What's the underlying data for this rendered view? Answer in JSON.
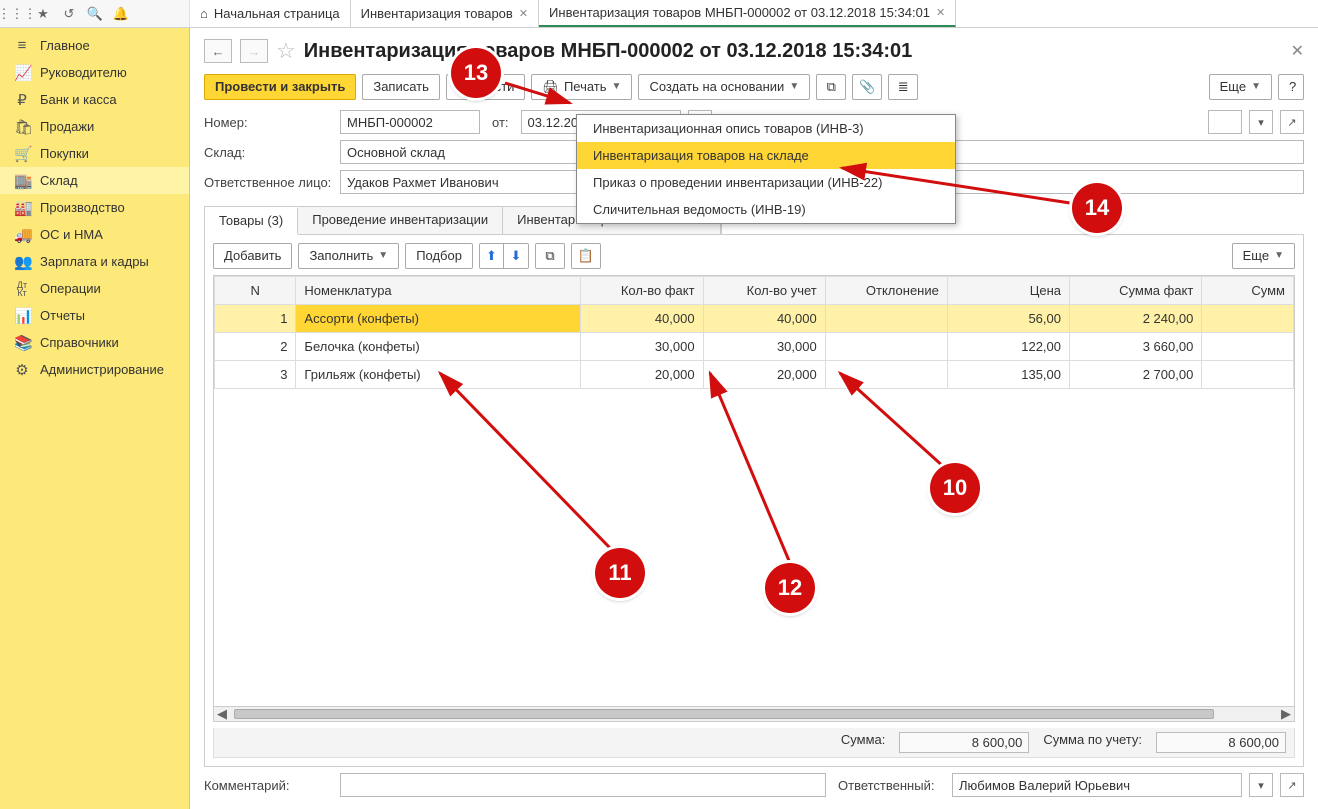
{
  "tabs": {
    "home": "Начальная страница",
    "t1": "Инвентаризация товаров",
    "t2": "Инвентаризация товаров МНБП-000002 от 03.12.2018 15:34:01"
  },
  "sidebar": [
    {
      "icon": "≡",
      "label": "Главное"
    },
    {
      "icon": "📈",
      "label": "Руководителю"
    },
    {
      "icon": "₽",
      "label": "Банк и касса"
    },
    {
      "icon": "🛍",
      "label": "Продажи"
    },
    {
      "icon": "🛒",
      "label": "Покупки"
    },
    {
      "icon": "🏬",
      "label": "Склад"
    },
    {
      "icon": "🏭",
      "label": "Производство"
    },
    {
      "icon": "🚚",
      "label": "ОС и НМА"
    },
    {
      "icon": "👥",
      "label": "Зарплата и кадры"
    },
    {
      "icon": "Дт Кт",
      "label": "Операции"
    },
    {
      "icon": "📊",
      "label": "Отчеты"
    },
    {
      "icon": "📚",
      "label": "Справочники"
    },
    {
      "icon": "⚙",
      "label": "Администрирование"
    }
  ],
  "title": "Инвентаризация товаров МНБП-000002 от 03.12.2018 15:34:01",
  "toolbar": {
    "post_close": "Провести и закрыть",
    "write": "Записать",
    "post": "Провести",
    "print": "Печать",
    "create_based": "Создать на основании",
    "more": "Еще"
  },
  "form": {
    "number_lbl": "Номер:",
    "number": "МНБП-000002",
    "from_lbl": "от:",
    "date": "03.12.2018 15:34:01",
    "warehouse_lbl": "Склад:",
    "warehouse": "Основной склад",
    "responsible_lbl": "Ответственное лицо:",
    "responsible": "Удаков Рахмет Иванович"
  },
  "print_menu": [
    "Инвентаризационная опись товаров (ИНВ-3)",
    "Инвентаризация товаров на складе",
    "Приказ о проведении инвентаризации (ИНВ-22)",
    "Сличительная ведомость (ИНВ-19)"
  ],
  "subtabs": [
    "Товары (3)",
    "Проведение инвентаризации",
    "Инвентаризационная комиссия"
  ],
  "grid_toolbar": {
    "add": "Добавить",
    "fill": "Заполнить",
    "pick": "Подбор",
    "more": "Еще"
  },
  "columns": [
    "N",
    "Номенклатура",
    "Кол-во факт",
    "Кол-во учет",
    "Отклонение",
    "Цена",
    "Сумма факт",
    "Сумм"
  ],
  "rows": [
    {
      "n": "1",
      "name": "Ассорти (конфеты)",
      "qf": "40,000",
      "qu": "40,000",
      "dev": "",
      "price": "56,00",
      "sf": "2 240,00"
    },
    {
      "n": "2",
      "name": "Белочка (конфеты)",
      "qf": "30,000",
      "qu": "30,000",
      "dev": "",
      "price": "122,00",
      "sf": "3 660,00"
    },
    {
      "n": "3",
      "name": "Грильяж (конфеты)",
      "qf": "20,000",
      "qu": "20,000",
      "dev": "",
      "price": "135,00",
      "sf": "2 700,00"
    }
  ],
  "totals": {
    "sum_lbl": "Сумма:",
    "sum": "8 600,00",
    "sum_acc_lbl": "Сумма по учету:",
    "sum_acc": "8 600,00"
  },
  "footer": {
    "comment_lbl": "Комментарий:",
    "resp_lbl": "Ответственный:",
    "resp": "Любимов Валерий Юрьевич"
  },
  "callouts": {
    "c10": "10",
    "c11": "11",
    "c12": "12",
    "c13": "13",
    "c14": "14"
  }
}
